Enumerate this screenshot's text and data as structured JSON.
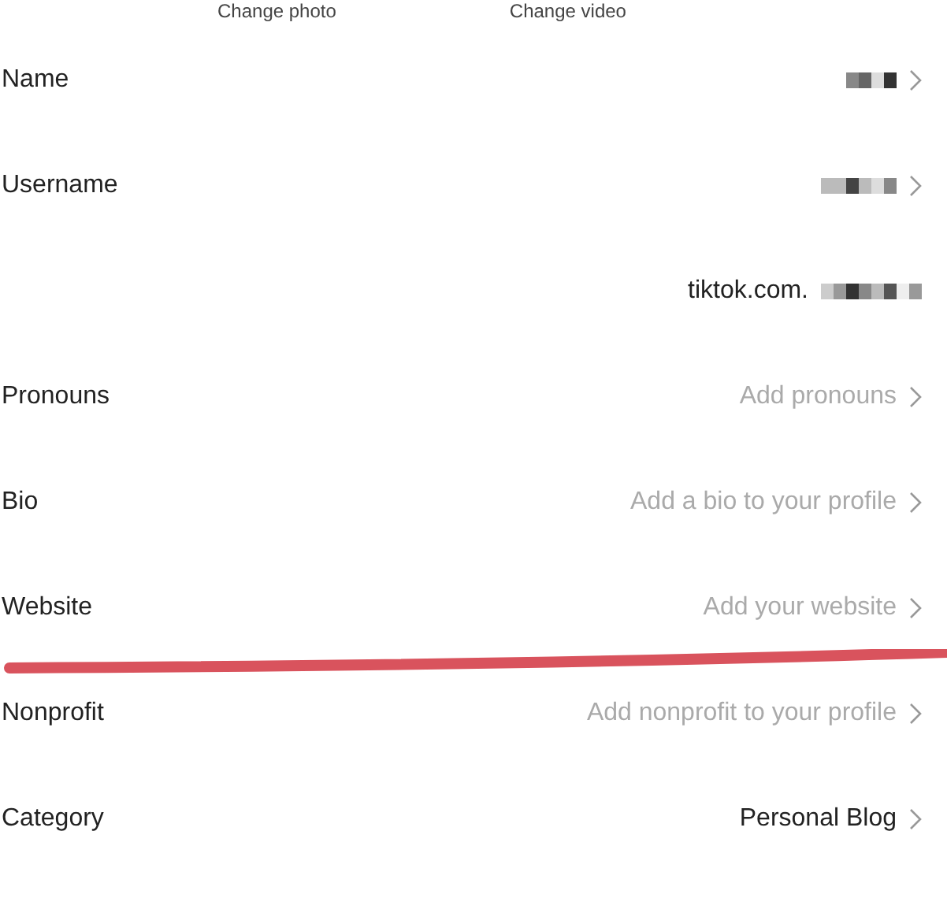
{
  "media_actions": [
    {
      "label": "Change photo"
    },
    {
      "label": "Change video"
    }
  ],
  "rows": [
    {
      "label": "Name",
      "kind": "redacted",
      "chevron": true,
      "underlined": false
    },
    {
      "label": "Username",
      "kind": "redacted",
      "chevron": true,
      "underlined": false
    },
    {
      "kind": "link",
      "text": "tiktok.com.",
      "chevron": false,
      "underlined": false
    },
    {
      "label": "Pronouns",
      "kind": "placeholder",
      "text": "Add pronouns",
      "chevron": true,
      "underlined": false
    },
    {
      "label": "Bio",
      "kind": "placeholder",
      "text": "Add a bio to your profile",
      "chevron": true,
      "underlined": false
    },
    {
      "label": "Website",
      "kind": "placeholder",
      "text": "Add your website",
      "chevron": true,
      "underlined": true
    },
    {
      "label": "Nonprofit",
      "kind": "placeholder",
      "text": "Add nonprofit to your profile",
      "chevron": true,
      "underlined": false
    },
    {
      "label": "Category",
      "kind": "value",
      "text": "Personal Blog",
      "chevron": true,
      "underlined": false
    }
  ]
}
